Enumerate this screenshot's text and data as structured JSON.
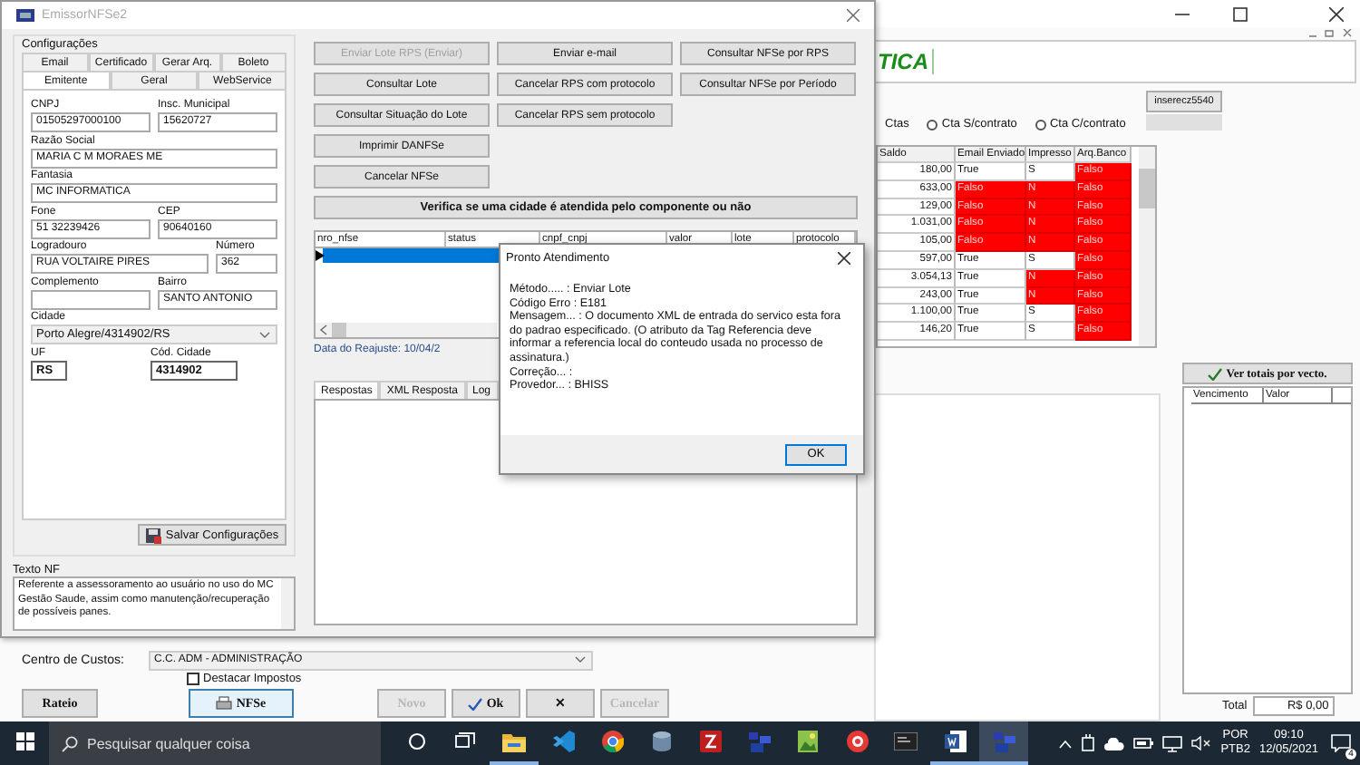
{
  "app": {
    "logo_text": "TICA",
    "user_button": "inserecz5540",
    "partial_option_label": "Ctas",
    "options": [
      {
        "label": "Cta S/contrato",
        "selected": false
      },
      {
        "label": "Cta C/contrato",
        "selected": false
      }
    ],
    "grid": {
      "columns": [
        "Saldo",
        "Email Enviado",
        "Impresso",
        "Arq.Banco"
      ],
      "rows": [
        {
          "cells": [
            {
              "text": "180,00",
              "flag": false
            },
            {
              "text": "True",
              "flag": false
            },
            {
              "text": "S",
              "flag": false
            },
            {
              "text": "Falso",
              "flag": true
            }
          ]
        },
        {
          "cells": [
            {
              "text": "633,00",
              "flag": false
            },
            {
              "text": "Falso",
              "flag": true
            },
            {
              "text": "N",
              "flag": true
            },
            {
              "text": "Falso",
              "flag": true
            }
          ]
        },
        {
          "cells": [
            {
              "text": "129,00",
              "flag": false
            },
            {
              "text": "Falso",
              "flag": true
            },
            {
              "text": "N",
              "flag": true
            },
            {
              "text": "Falso",
              "flag": true
            }
          ]
        },
        {
          "cells": [
            {
              "text": "1.031,00",
              "flag": false
            },
            {
              "text": "Falso",
              "flag": true
            },
            {
              "text": "N",
              "flag": true
            },
            {
              "text": "Falso",
              "flag": true
            }
          ]
        },
        {
          "cells": [
            {
              "text": "105,00",
              "flag": false
            },
            {
              "text": "Falso",
              "flag": true
            },
            {
              "text": "N",
              "flag": true
            },
            {
              "text": "Falso",
              "flag": true
            }
          ]
        },
        {
          "cells": [
            {
              "text": "597,00",
              "flag": false
            },
            {
              "text": "True",
              "flag": false
            },
            {
              "text": "S",
              "flag": false
            },
            {
              "text": "Falso",
              "flag": true
            }
          ]
        },
        {
          "cells": [
            {
              "text": "3.054,13",
              "flag": false
            },
            {
              "text": "True",
              "flag": false
            },
            {
              "text": "N",
              "flag": true
            },
            {
              "text": "Falso",
              "flag": true
            }
          ]
        },
        {
          "cells": [
            {
              "text": "243,00",
              "flag": false
            },
            {
              "text": "True",
              "flag": false
            },
            {
              "text": "N",
              "flag": true
            },
            {
              "text": "Falso",
              "flag": true
            }
          ]
        },
        {
          "cells": [
            {
              "text": "1.100,00",
              "flag": false
            },
            {
              "text": "True",
              "flag": false
            },
            {
              "text": "S",
              "flag": false
            },
            {
              "text": "Falso",
              "flag": true
            }
          ]
        },
        {
          "cells": [
            {
              "text": "146,20",
              "flag": false
            },
            {
              "text": "True",
              "flag": false
            },
            {
              "text": "S",
              "flag": false
            },
            {
              "text": "Falso",
              "flag": true
            }
          ]
        }
      ]
    },
    "totals": {
      "button": "Ver totais por vecto.",
      "columns": [
        "Vencimento",
        "Valor"
      ],
      "total_label": "Total",
      "total_value": "R$ 0,00"
    },
    "cost_center": {
      "label": "Centro de Custos:",
      "value": "C.C. ADM - ADMINISTRAÇÃO"
    },
    "highlight_taxes": {
      "label": "Destacar Impostos",
      "checked": false
    },
    "rateio_button": "Rateio",
    "nfse_button": "NFSe",
    "actions": [
      {
        "label": "Novo",
        "disabled": true
      },
      {
        "label": "Ok",
        "disabled": false
      },
      {
        "label": "✕",
        "disabled": false
      },
      {
        "label": "Cancelar",
        "disabled": true
      }
    ]
  },
  "emissor": {
    "title": "EmissorNFSe2",
    "group_title": "Configurações",
    "tabs_back": [
      {
        "label": "Email",
        "selected": false
      },
      {
        "label": "Certificado",
        "selected": false
      },
      {
        "label": "Gerar Arq.",
        "selected": false
      },
      {
        "label": "Boleto",
        "selected": false
      }
    ],
    "tabs_front": [
      {
        "label": "Emitente",
        "selected": true
      },
      {
        "label": "Geral",
        "selected": false
      },
      {
        "label": "WebService",
        "selected": false
      }
    ],
    "field_rows": [
      [
        {
          "label": "CNPJ",
          "value": "01505297000100",
          "kind": "text"
        },
        {
          "label": "Insc. Municipal",
          "value": "15620727",
          "kind": "text"
        }
      ],
      [
        {
          "label": "Razão Social",
          "value": "MARIA C M MORAES ME",
          "kind": "text"
        }
      ],
      [
        {
          "label": "Fantasia",
          "value": "MC INFORMATICA",
          "kind": "text"
        }
      ],
      [
        {
          "label": "Fone",
          "value": "51 32239426",
          "kind": "text"
        },
        {
          "label": "CEP",
          "value": "90640160",
          "kind": "text"
        }
      ],
      [
        {
          "label": "Logradouro",
          "value": "RUA VOLTAIRE PIRES",
          "kind": "text"
        },
        {
          "label": "Número",
          "value": "362",
          "kind": "text"
        }
      ],
      [
        {
          "label": "Complemento",
          "kind": "text"
        },
        {
          "label": "Bairro",
          "value": "SANTO ANTONIO",
          "kind": "text"
        }
      ],
      [
        {
          "label": "Cidade",
          "value": "Porto Alegre/4314902/RS",
          "kind": "combo"
        }
      ],
      [
        {
          "label": "UF",
          "value": "RS",
          "kind": "bold"
        },
        {
          "label": "Cód. Cidade",
          "value": "4314902",
          "kind": "bold"
        }
      ]
    ],
    "save_button": "Salvar Configurações",
    "note_label": "Texto NF",
    "note_text": "Referente a assessoramento ao usuário no uso do MC Gestão Saude, assim como manutenção/recuperação de possíveis panes.",
    "button_columns": [
      [
        {
          "label": "Enviar Lote RPS (Enviar)",
          "disabled": true
        },
        {
          "label": "Consultar Lote",
          "disabled": false
        },
        {
          "label": "Consultar Situação do Lote",
          "disabled": false
        },
        {
          "label": "Imprimir DANFSe",
          "disabled": false
        },
        {
          "label": "Cancelar NFSe",
          "disabled": false
        }
      ],
      [
        {
          "label": "Enviar e-mail",
          "disabled": false
        },
        {
          "label": "Cancelar RPS com protocolo",
          "disabled": false
        },
        {
          "label": "Cancelar RPS sem protocolo",
          "disabled": false
        }
      ],
      [
        {
          "label": "Consultar NFSe por RPS",
          "disabled": false
        },
        {
          "label": "Consultar NFSe por Período",
          "disabled": false
        }
      ]
    ],
    "verify_button": "Verifica se uma cidade é atendida pelo componente ou não",
    "nfse_grid": {
      "columns": [
        "nro_nfse",
        "status",
        "cnpf_cnpj",
        "valor",
        "lote",
        "protocolo"
      ],
      "rows": [
        {
          "selected": true
        }
      ]
    },
    "adjust_date": "Data do Reajuste: 10/04/2",
    "response_tabs": [
      {
        "label": "Respostas",
        "selected": true
      },
      {
        "label": "XML Resposta",
        "selected": false
      },
      {
        "label": "Log",
        "selected": false
      }
    ]
  },
  "dialog": {
    "title": "Pronto Atendimento",
    "lines": [
      "Método..... : Enviar Lote",
      "Código Erro : E181",
      "Mensagem... : O documento XML de entrada do servico esta fora do padrao especificado. (O atributo da Tag Referencia deve informar a referencia local do conteudo usada no processo de assinatura.)",
      "Correção... :",
      "Provedor... : BHISS"
    ],
    "ok_button": "OK"
  },
  "taskbar": {
    "search_placeholder": "Pesquisar qualquer coisa",
    "apps": [
      {
        "kind": "folder",
        "running": true,
        "selected": false
      },
      {
        "kind": "code",
        "running": false,
        "selected": false
      },
      {
        "kind": "browser",
        "running": false,
        "selected": false
      },
      {
        "kind": "database",
        "running": false,
        "selected": false
      },
      {
        "kind": "transfer",
        "running": false,
        "selected": false
      },
      {
        "kind": "blocks",
        "running": false,
        "selected": false
      },
      {
        "kind": "image",
        "running": false,
        "selected": false
      },
      {
        "kind": "round",
        "running": false,
        "selected": false
      },
      {
        "kind": "terminal",
        "running": false,
        "selected": false
      },
      {
        "kind": "document",
        "running": true,
        "selected": false
      },
      {
        "kind": "blocks",
        "running": true,
        "selected": true
      }
    ],
    "language": "POR",
    "layout": "PTB2",
    "time": "09:10",
    "date": "12/05/2021",
    "notifications": "4"
  }
}
